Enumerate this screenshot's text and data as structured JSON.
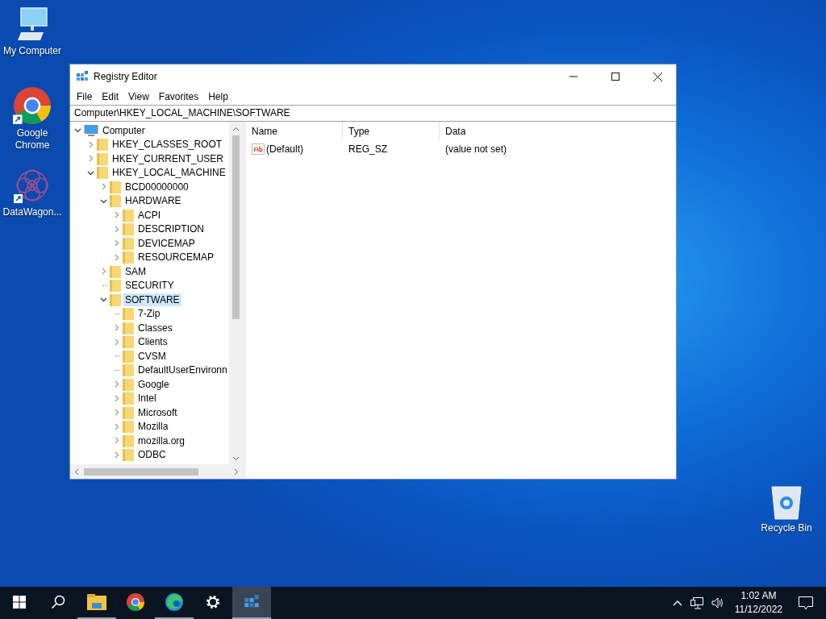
{
  "desktop_icons": [
    {
      "label": "My Computer",
      "kind": "computer",
      "shortcut": false
    },
    {
      "label": "Google Chrome",
      "kind": "chrome",
      "shortcut": true
    },
    {
      "label": "DataWagon...",
      "kind": "datawagon",
      "shortcut": true
    }
  ],
  "recycle_bin": {
    "label": "Recycle Bin"
  },
  "window": {
    "title": "Registry Editor",
    "menu": [
      "File",
      "Edit",
      "View",
      "Favorites",
      "Help"
    ],
    "address": "Computer\\HKEY_LOCAL_MACHINE\\SOFTWARE",
    "tree": [
      {
        "label": "Computer",
        "kind": "computer",
        "expanded": true,
        "selected": false,
        "children": [
          {
            "label": "HKEY_CLASSES_ROOT",
            "kind": "branch",
            "expanded": false,
            "selected": false
          },
          {
            "label": "HKEY_CURRENT_USER",
            "kind": "branch",
            "expanded": false,
            "selected": false
          },
          {
            "label": "HKEY_LOCAL_MACHINE",
            "kind": "branch",
            "expanded": true,
            "selected": false,
            "children": [
              {
                "label": "BCD00000000",
                "kind": "branch",
                "expanded": false,
                "selected": false
              },
              {
                "label": "HARDWARE",
                "kind": "branch",
                "expanded": true,
                "selected": false,
                "children": [
                  {
                    "label": "ACPI",
                    "kind": "branch",
                    "expanded": false,
                    "selected": false
                  },
                  {
                    "label": "DESCRIPTION",
                    "kind": "branch",
                    "expanded": false,
                    "selected": false
                  },
                  {
                    "label": "DEVICEMAP",
                    "kind": "branch",
                    "expanded": false,
                    "selected": false
                  },
                  {
                    "label": "RESOURCEMAP",
                    "kind": "branch",
                    "expanded": false,
                    "selected": false
                  }
                ]
              },
              {
                "label": "SAM",
                "kind": "branch",
                "expanded": false,
                "selected": false
              },
              {
                "label": "SECURITY",
                "kind": "leaf",
                "selected": false
              },
              {
                "label": "SOFTWARE",
                "kind": "branch",
                "expanded": true,
                "selected": true,
                "children": [
                  {
                    "label": "7-Zip",
                    "kind": "leaf",
                    "selected": false
                  },
                  {
                    "label": "Classes",
                    "kind": "branch",
                    "expanded": false,
                    "selected": false
                  },
                  {
                    "label": "Clients",
                    "kind": "branch",
                    "expanded": false,
                    "selected": false
                  },
                  {
                    "label": "CVSM",
                    "kind": "leaf",
                    "selected": false
                  },
                  {
                    "label": "DefaultUserEnvironn",
                    "kind": "leaf",
                    "selected": false
                  },
                  {
                    "label": "Google",
                    "kind": "branch",
                    "expanded": false,
                    "selected": false
                  },
                  {
                    "label": "Intel",
                    "kind": "branch",
                    "expanded": false,
                    "selected": false
                  },
                  {
                    "label": "Microsoft",
                    "kind": "branch",
                    "expanded": false,
                    "selected": false
                  },
                  {
                    "label": "Mozilla",
                    "kind": "branch",
                    "expanded": false,
                    "selected": false
                  },
                  {
                    "label": "mozilla.org",
                    "kind": "branch",
                    "expanded": false,
                    "selected": false
                  },
                  {
                    "label": "ODBC",
                    "kind": "branch",
                    "expanded": false,
                    "selected": false
                  }
                ]
              }
            ]
          }
        ]
      }
    ],
    "columns": [
      "Name",
      "Type",
      "Data"
    ],
    "values": [
      {
        "name": "(Default)",
        "type": "REG_SZ",
        "data": "(value not set)"
      }
    ]
  },
  "taskbar": {
    "apps": [
      {
        "kind": "explorer",
        "active": false,
        "running": true
      },
      {
        "kind": "chrome",
        "active": false,
        "running": false
      },
      {
        "kind": "edge",
        "active": false,
        "running": true
      },
      {
        "kind": "settings",
        "active": false,
        "running": false
      },
      {
        "kind": "regedit",
        "active": true,
        "running": true
      }
    ],
    "time": "1:02 AM",
    "date": "11/12/2022"
  }
}
